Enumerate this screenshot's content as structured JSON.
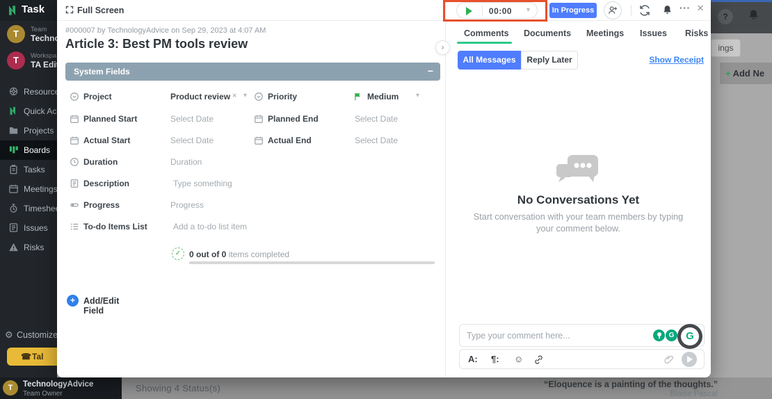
{
  "icons": {
    "caret_down": "▾",
    "close": "×",
    "dots": "···",
    "chevron_right": "›",
    "minus": "−",
    "plus": "+",
    "check": "✓",
    "gear": "⚙",
    "warning": "⚠",
    "smiley": "☺",
    "phone": "☎",
    "question": "?",
    "text_format": "A:",
    "paragraph": "¶:"
  },
  "sidebar": {
    "logo_text": "Task",
    "team": {
      "avatar": "T",
      "label": "Team",
      "name": "Techno"
    },
    "workspace": {
      "avatar": "T",
      "label": "Workspa",
      "name": "TA Edit"
    },
    "items": [
      {
        "label": "Resource V"
      },
      {
        "label": "Quick Acce"
      },
      {
        "label": "Projects"
      },
      {
        "label": "Boards"
      },
      {
        "label": "Tasks"
      },
      {
        "label": "Meetings"
      },
      {
        "label": "Timesheet"
      },
      {
        "label": "Issues"
      },
      {
        "label": "Risks"
      }
    ],
    "customize_label": "Customize M",
    "talk_label": "Tal",
    "footer": {
      "avatar": "T",
      "name": "TechnologyAdvice",
      "role": "Team Owner"
    }
  },
  "modal": {
    "fullscreen_label": "Full Screen",
    "meta": "#000007 by TechnologyAdvice on Sep 29, 2023 at 4:07 AM",
    "title": "Article 3: Best PM tools review",
    "system_fields_header": "System Fields",
    "fields": {
      "project": {
        "label": "Project",
        "value": "Product review"
      },
      "priority": {
        "label": "Priority",
        "value": "Medium"
      },
      "planned_start": {
        "label": "Planned Start",
        "value": "Select Date"
      },
      "planned_end": {
        "label": "Planned End",
        "value": "Select Date"
      },
      "actual_start": {
        "label": "Actual Start",
        "value": "Select Date"
      },
      "actual_end": {
        "label": "Actual End",
        "value": "Select Date"
      },
      "duration": {
        "label": "Duration",
        "placeholder": "Duration"
      },
      "description": {
        "label": "Description",
        "placeholder": "Type something"
      },
      "progress": {
        "label": "Progress",
        "placeholder": "Progress"
      },
      "todo": {
        "label": "To-do Items List",
        "placeholder": "Add a to-do list item",
        "summary_bold": "0 out of 0",
        "summary_rest": " items completed"
      }
    },
    "add_edit_label": "Add/Edit Field"
  },
  "task_toolbar": {
    "timer": "00:00",
    "status": "In Progress"
  },
  "comments_panel": {
    "tabs": [
      {
        "label": "Comments"
      },
      {
        "label": "Documents"
      },
      {
        "label": "Meetings"
      },
      {
        "label": "Issues"
      },
      {
        "label": "Risks"
      }
    ],
    "filter_all": "All Messages",
    "filter_reply": "Reply Later",
    "show_receipt": "Show Receipt",
    "empty_title": "No Conversations Yet",
    "empty_line1": "Start conversation with your team members by typing",
    "empty_line2": "your comment below.",
    "input_placeholder": "Type your comment here...",
    "grammarly_g": "G"
  },
  "background": {
    "partial_tab": "ings",
    "add_new_plus": "+",
    "add_new_text": "Add Ne",
    "status_text": "Showing 4 Status(s)",
    "quote": "“Eloquence is a painting of the thoughts.”",
    "quote_author": "- Blaise Pascal"
  }
}
